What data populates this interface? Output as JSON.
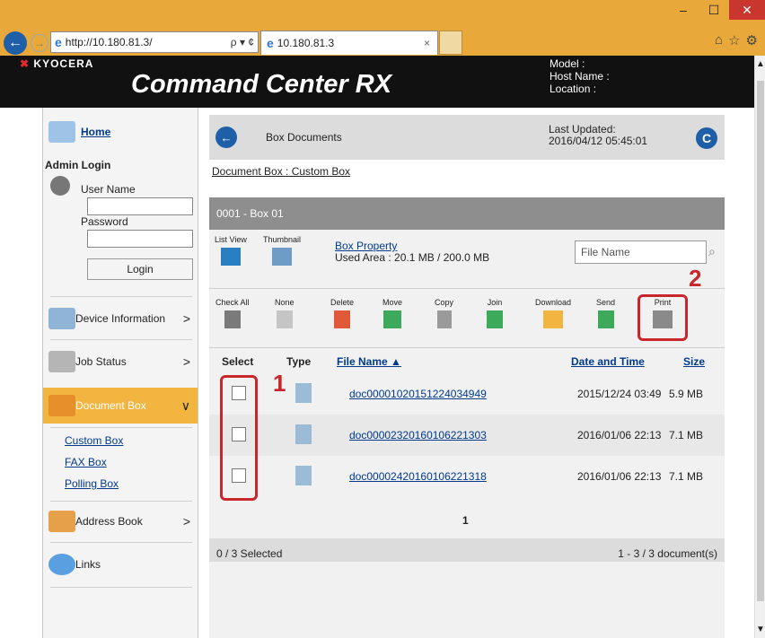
{
  "browser": {
    "url": "http://10.180.81.3/",
    "address_controls": "ρ ▾ ¢",
    "tab_title": "10.180.81.3",
    "tab_close": "×"
  },
  "header": {
    "logo": "KYOCERA",
    "app_name": "Command Center RX",
    "model_label": "Model :",
    "host_label": "Host Name :",
    "location_label": "Location :"
  },
  "sidebar": {
    "home": "Home",
    "admin_login": "Admin Login",
    "user_name_label": "User Name",
    "password_label": "Password",
    "login_button": "Login",
    "items": [
      {
        "label": "Device Information",
        "chevron": ">"
      },
      {
        "label": "Job Status",
        "chevron": ">"
      },
      {
        "label": "Document Box",
        "chevron": "∨"
      },
      {
        "label": "Address Book",
        "chevron": ">"
      },
      {
        "label": "Links"
      }
    ],
    "sub_links": [
      "Custom Box",
      "FAX Box",
      "Polling Box"
    ]
  },
  "main": {
    "title": "Box Documents",
    "last_updated_label": "Last Updated:",
    "last_updated_value": "2016/04/12 05:45:01",
    "breadcrumb": "Document Box : Custom Box",
    "panel_title": "0001 - Box 01",
    "view_tools": [
      "List View",
      "Thumbnail"
    ],
    "box_property_link": "Box Property",
    "used_area": "Used Area : 20.1 MB / 200.0 MB",
    "file_name_placeholder": "File Name",
    "actions": [
      "Check All",
      "None",
      "Delete",
      "Move",
      "Copy",
      "Join",
      "Download",
      "Send",
      "Print"
    ],
    "columns": [
      "Select",
      "Type",
      "File Name ▲",
      "Date and Time",
      "Size"
    ],
    "rows": [
      {
        "name": "doc00001020151224034949",
        "date": "2015/12/24 03:49",
        "size": "5.9 MB"
      },
      {
        "name": "doc00002320160106221303",
        "date": "2016/01/06 22:13",
        "size": "7.1 MB"
      },
      {
        "name": "doc00002420160106221318",
        "date": "2016/01/06 22:13",
        "size": "7.1 MB"
      }
    ],
    "page": "1",
    "selected_status": "0 / 3 Selected",
    "doc_count": "1 - 3 / 3 document(s)"
  },
  "callouts": {
    "one": "1",
    "two": "2"
  },
  "colors": {
    "accent": "#f2b540",
    "brand_red": "#e32b2b",
    "highlight": "#c9262c",
    "link": "#003a8c"
  }
}
